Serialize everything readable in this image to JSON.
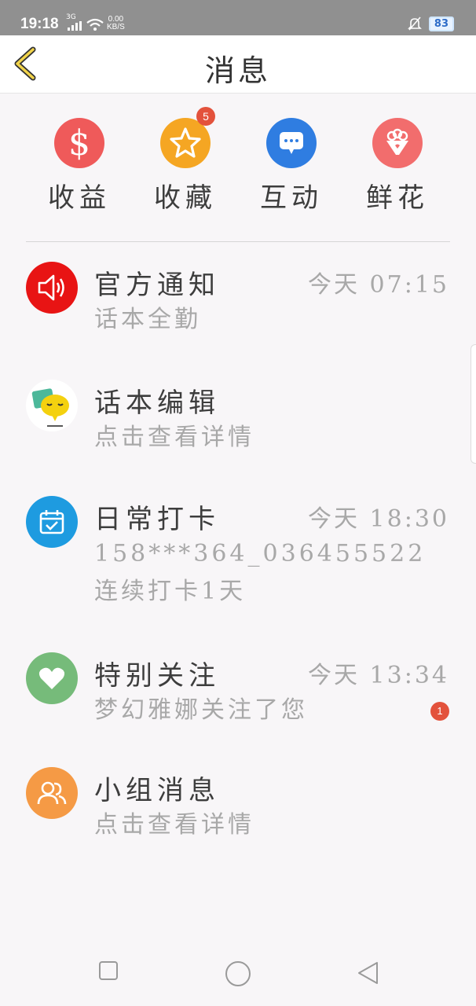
{
  "status_bar": {
    "time": "19:18",
    "network": "3G",
    "speed_value": "0.00",
    "speed_unit": "KB/S",
    "battery": "83"
  },
  "header": {
    "title": "消息"
  },
  "quick_actions": [
    {
      "label": "收益",
      "icon": "dollar-icon",
      "color": "#ef5a5a"
    },
    {
      "label": "收藏",
      "icon": "star-icon",
      "color": "#f5a623",
      "badge": "5"
    },
    {
      "label": "互动",
      "icon": "chat-bubble-icon",
      "color": "#2f7de1"
    },
    {
      "label": "鲜花",
      "icon": "flower-bouquet-icon",
      "color": "#f26d6d"
    }
  ],
  "messages": [
    {
      "title": "官方通知",
      "time": "今天 07:15",
      "desc": "话本全勤",
      "icon": "speaker-icon",
      "color": "#e81414"
    },
    {
      "title": "话本编辑",
      "time": "",
      "desc": "点击查看详情",
      "icon": "mascot-avatar-icon",
      "color": "#ffffff"
    },
    {
      "title": "日常打卡",
      "time": "今天 18:30",
      "desc": "158***364_036455522连续打卡1天",
      "icon": "calendar-check-icon",
      "color": "#1e9be0"
    },
    {
      "title": "特别关注",
      "time": "今天 13:34",
      "desc": "梦幻雅娜关注了您",
      "icon": "heart-icon",
      "color": "#76bb7a",
      "unread": "1"
    },
    {
      "title": "小组消息",
      "time": "",
      "desc": "点击查看详情",
      "icon": "group-users-icon",
      "color": "#f59a45"
    }
  ]
}
